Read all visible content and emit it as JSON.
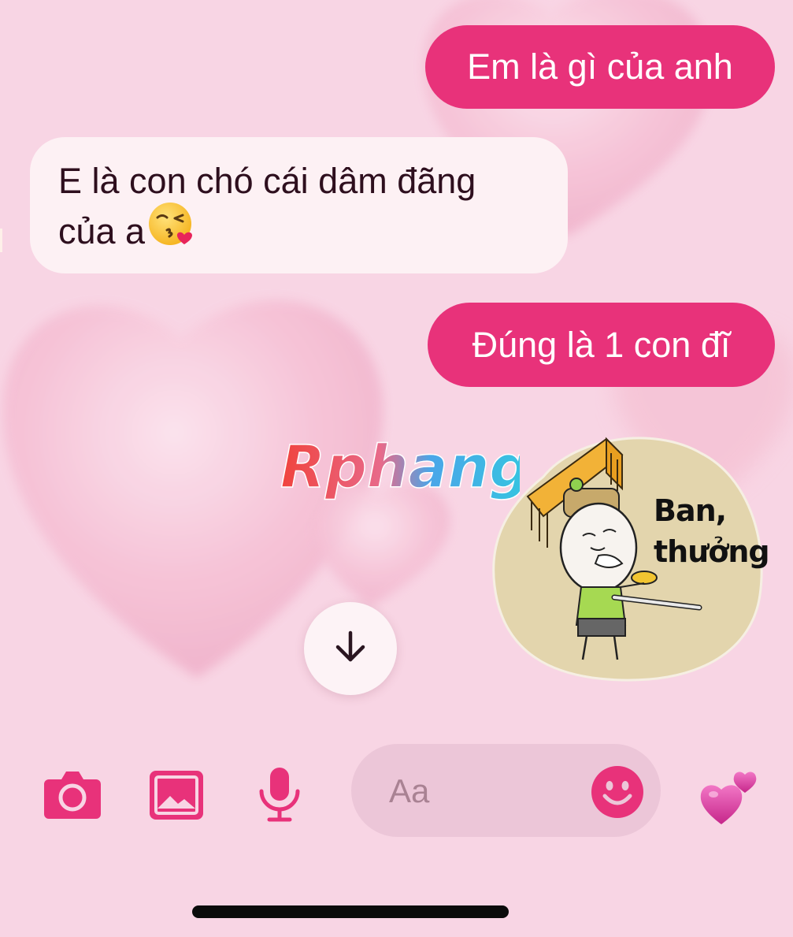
{
  "conversation": {
    "messages": [
      {
        "direction": "sent",
        "text": "Em là gì của anh"
      },
      {
        "direction": "received",
        "text": "E là con chó cái dâm đãng của a",
        "emoji": "kissing-heart-emoji"
      },
      {
        "direction": "sent",
        "text": "Đúng là 1 con đĩ"
      },
      {
        "direction": "sent",
        "type": "sticker",
        "sticker_text": "Ban, thưởng"
      }
    ]
  },
  "watermark": {
    "text": "Rphang"
  },
  "scroll_button": {
    "icon": "arrow-down-icon"
  },
  "composer": {
    "placeholder": "Aa",
    "tools": [
      "camera-icon",
      "image-icon",
      "microphone-icon"
    ],
    "emoji_icon": "smiley-icon",
    "like_icon": "two-hearts-icon"
  },
  "colors": {
    "background": "#f7d3e3",
    "accent": "#e8327a",
    "sent_bubble": "#e8327a",
    "received_bubble": "#fdf1f4",
    "received_text": "#2e0f1e",
    "composer_bg": "#ecc6d8"
  }
}
